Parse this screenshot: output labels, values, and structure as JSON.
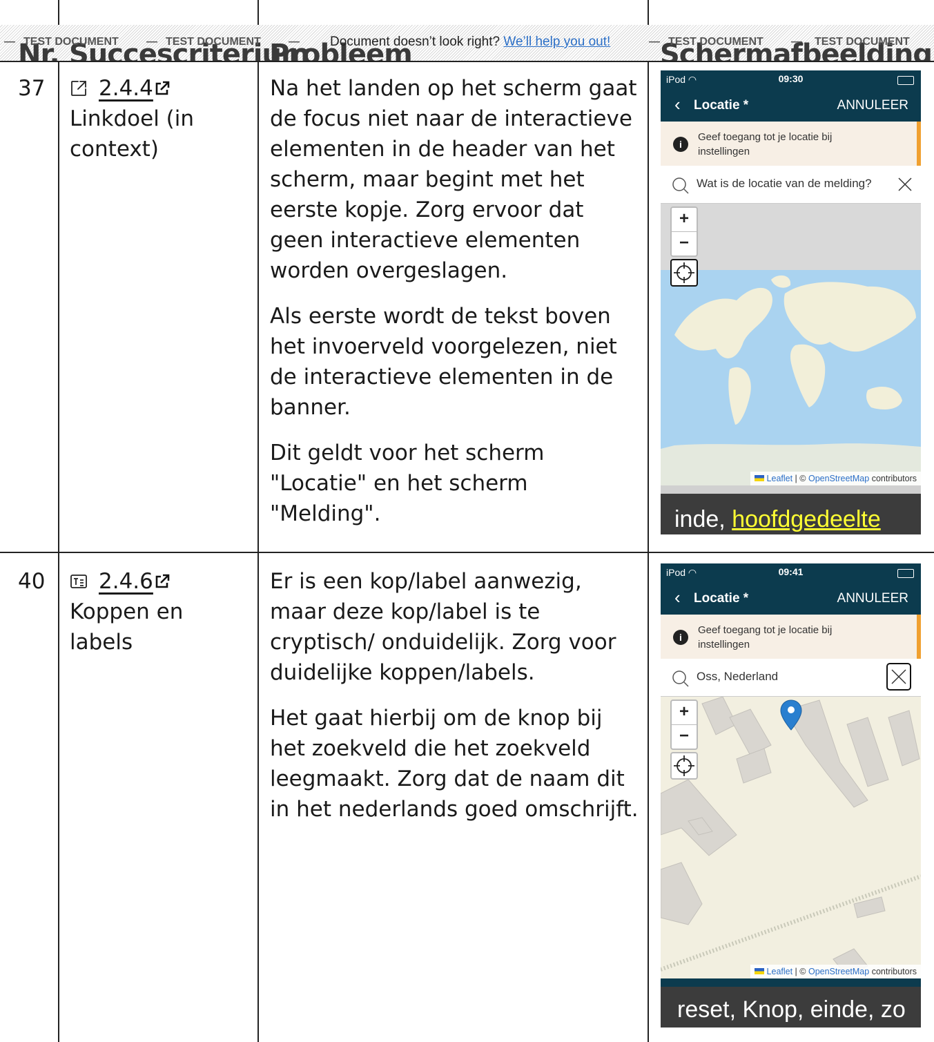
{
  "header": {
    "col_nr": "Nr.",
    "col_criterium": "Succescriterium",
    "col_probleem": "Probleem",
    "col_screenshot": "Schermafbeelding"
  },
  "watermark": {
    "label": "TEST DOCUMENT",
    "dash": "—",
    "notice_text": "Document doesn’t look right?",
    "notice_link": "We’ll help you out!"
  },
  "rows": [
    {
      "nr": "37",
      "criterion_code": "2.4.4",
      "criterion_name": "Linkdoel (in context)",
      "criterion_icon": "external-link-square-icon",
      "paragraphs": [
        "Na het landen op het scherm gaat de focus niet naar de interactieve elementen in de header van het scherm, maar begint met het eerste kopje. Zorg ervoor dat geen interactieve elementen worden overgeslagen.",
        "Als eerste wordt de tekst boven het invoerveld voorgelezen, niet de interactieve elementen in de banner.",
        "Dit geldt voor het scherm \"Locatie\" en het scherm \"Melding\"."
      ],
      "phone": {
        "device": "iPod",
        "time": "09:30",
        "title": "Locatie *",
        "cancel": "ANNULEER",
        "info": "Geef toegang tot je locatie bij instellingen",
        "search_placeholder": "Wat is de locatie van de melding?",
        "zoom_in": "+",
        "zoom_out": "−",
        "attr_leaflet": "Leaflet",
        "attr_sep": " | © ",
        "attr_osm": "OpenStreetMap",
        "attr_tail": " contributors",
        "voiceover_prefix": "inde, ",
        "voiceover_highlight": "hoofdgedeelte"
      }
    },
    {
      "nr": "40",
      "criterion_code": "2.4.6",
      "criterion_name": "Koppen en labels",
      "criterion_icon": "heading-label-icon",
      "paragraphs": [
        "Er is een kop/label aanwezig, maar deze kop/label is te cryptisch/ onduidelijk. Zorg voor duidelijke koppen/labels.",
        "Het gaat hierbij om de knop bij het zoekveld die het zoekveld leegmaakt. Zorg dat de naam dit in het nederlands goed omschrijft."
      ],
      "phone": {
        "device": "iPod",
        "time": "09:41",
        "title": "Locatie *",
        "cancel": "ANNULEER",
        "info": "Geef toegang tot je locatie bij instellingen",
        "search_value": "Oss, Nederland",
        "zoom_in": "+",
        "zoom_out": "−",
        "attr_leaflet": "Leaflet",
        "attr_sep": " | © ",
        "attr_osm": "OpenStreetMap",
        "attr_tail": " contributors",
        "voiceover_text": "reset, Knop, einde, zo"
      }
    }
  ],
  "colors": {
    "nav_bg": "#0c3b4e",
    "info_accent": "#f0a030",
    "link": "#2b6fc7",
    "voiceover_highlight": "#ffff33"
  }
}
